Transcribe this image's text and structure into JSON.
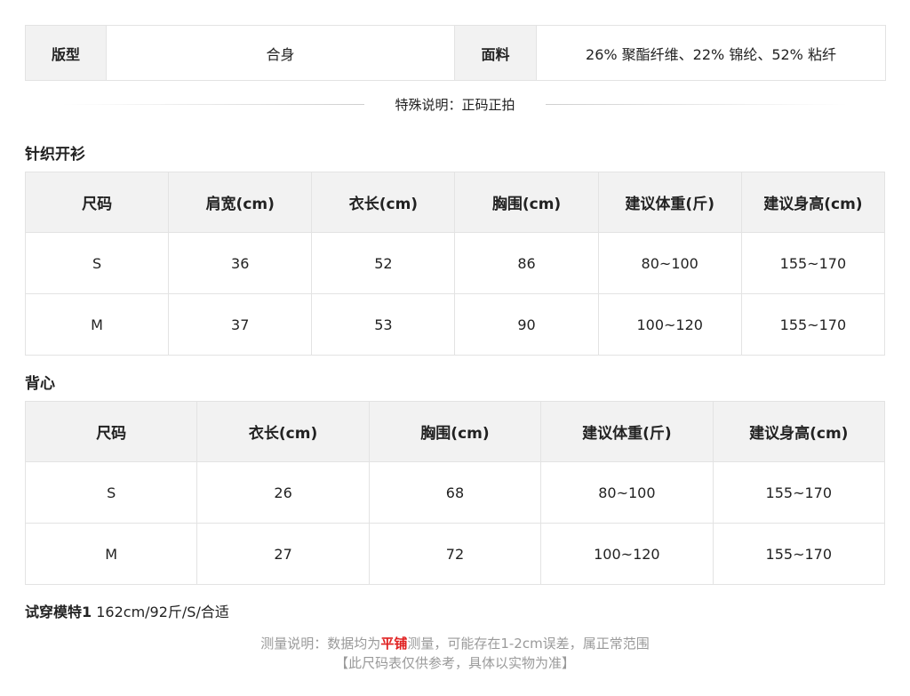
{
  "info": {
    "fit_label": "版型",
    "fit_value": "合身",
    "fabric_label": "面料",
    "fabric_value": "26% 聚酯纤维、22% 锦纶、52% 粘纤"
  },
  "special_note": "特殊说明：正码正拍",
  "cardigan": {
    "title": "针织开衫",
    "headers": [
      "尺码",
      "肩宽(cm)",
      "衣长(cm)",
      "胸围(cm)",
      "建议体重(斤)",
      "建议身高(cm)"
    ],
    "rows": [
      [
        "S",
        "36",
        "52",
        "86",
        "80~100",
        "155~170"
      ],
      [
        "M",
        "37",
        "53",
        "90",
        "100~120",
        "155~170"
      ]
    ]
  },
  "vest": {
    "title": "背心",
    "headers": [
      "尺码",
      "衣长(cm)",
      "胸围(cm)",
      "建议体重(斤)",
      "建议身高(cm)"
    ],
    "rows": [
      [
        "S",
        "26",
        "68",
        "80~100",
        "155~170"
      ],
      [
        "M",
        "27",
        "72",
        "100~120",
        "155~170"
      ]
    ]
  },
  "model": {
    "label": "试穿模特1",
    "value": " 162cm/92斤/S/合适"
  },
  "footer": {
    "line1_pre": "测量说明：数据均为",
    "line1_highlight": "平铺",
    "line1_post": "测量，可能存在1-2cm误差，属正常范围",
    "line2": "【此尺码表仅供参考，具体以实物为准】"
  }
}
